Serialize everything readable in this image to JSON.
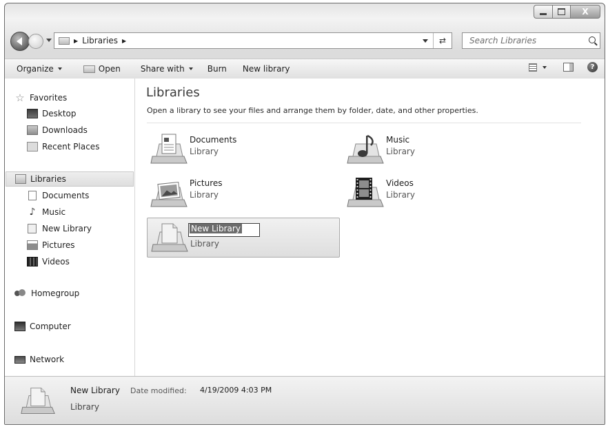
{
  "window": {
    "buttons": {
      "minimize": "minimize",
      "maximize": "maximize",
      "close": "X"
    }
  },
  "address_bar": {
    "crumbs": [
      "Libraries"
    ],
    "search_placeholder": "Search Libraries"
  },
  "toolbar": {
    "organize": "Organize",
    "open": "Open",
    "share_with": "Share with",
    "burn": "Burn",
    "new_library": "New library"
  },
  "nav": {
    "favorites": {
      "label": "Favorites",
      "items": [
        {
          "label": "Desktop",
          "icon": "desktop-icon"
        },
        {
          "label": "Downloads",
          "icon": "downloads-icon"
        },
        {
          "label": "Recent Places",
          "icon": "recent-places-icon"
        }
      ]
    },
    "libraries": {
      "label": "Libraries",
      "items": [
        {
          "label": "Documents",
          "icon": "documents-icon"
        },
        {
          "label": "Music",
          "icon": "music-icon"
        },
        {
          "label": "New Library",
          "icon": "library-icon"
        },
        {
          "label": "Pictures",
          "icon": "pictures-icon"
        },
        {
          "label": "Videos",
          "icon": "videos-icon"
        }
      ]
    },
    "homegroup": "Homegroup",
    "computer": "Computer",
    "network": "Network"
  },
  "content": {
    "title": "Libraries",
    "description": "Open a library to see your files and arrange them by folder, date, and other properties.",
    "libraries": [
      {
        "name": "Documents",
        "type": "Library",
        "icon": "documents-library-icon"
      },
      {
        "name": "Music",
        "type": "Library",
        "icon": "music-library-icon"
      },
      {
        "name": "Pictures",
        "type": "Library",
        "icon": "pictures-library-icon"
      },
      {
        "name": "Videos",
        "type": "Library",
        "icon": "videos-library-icon"
      },
      {
        "name": "New Library",
        "type": "Library",
        "icon": "new-library-icon",
        "renaming": true
      }
    ]
  },
  "details": {
    "name": "New Library",
    "modified_label": "Date modified:",
    "modified_value": "4/19/2009 4:03 PM",
    "type": "Library"
  }
}
